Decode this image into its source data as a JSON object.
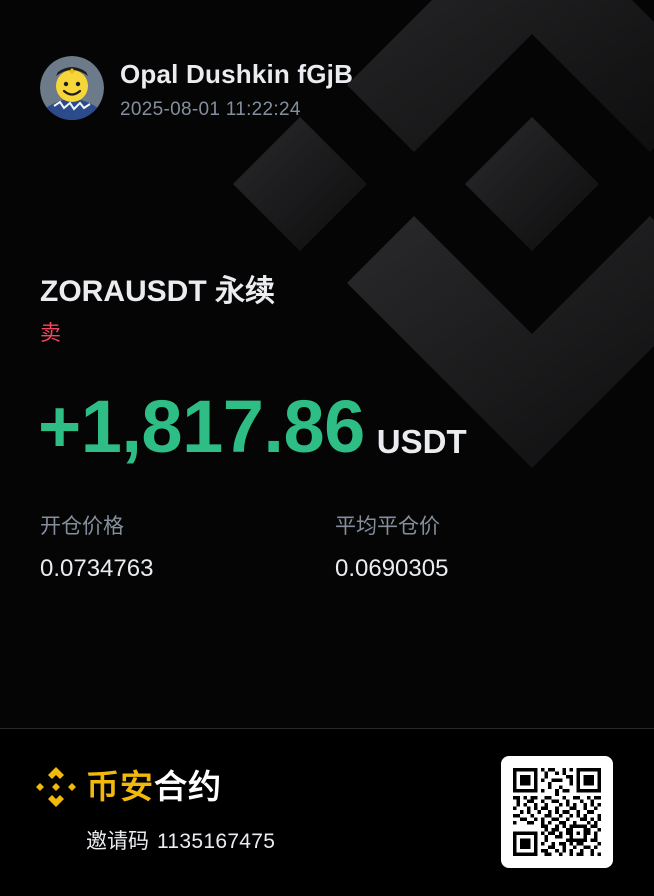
{
  "user": {
    "name": "Opal Dushkin fGjB",
    "timestamp": "2025-08-01 11:22:24",
    "avatar_icon": "smiley-avatar-icon"
  },
  "position": {
    "symbol": "ZORAUSDT 永续",
    "side": "卖",
    "pnl": "+1,817.86",
    "pnl_unit": "USDT"
  },
  "stats": {
    "open_label": "开仓价格",
    "open_value": "0.0734763",
    "close_label": "平均平仓价",
    "close_value": "0.0690305"
  },
  "footer": {
    "brand_part1": "币安",
    "brand_part2": "合约",
    "referral_label": "邀请码",
    "referral_code": "1135167475",
    "logo_icon": "binance-logo-icon",
    "qr_icon": "qr-code-icon"
  },
  "colors": {
    "profit": "#2ebd85",
    "sell": "#f6465d",
    "brand": "#f0b90b",
    "muted": "#848e9c"
  }
}
